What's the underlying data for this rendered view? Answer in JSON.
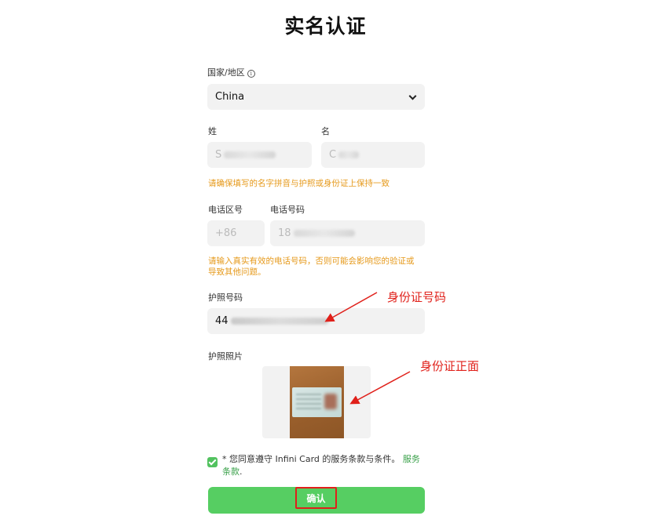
{
  "title": "实名认证",
  "country": {
    "label": "国家/地区",
    "info_icon": "info-icon",
    "value": "China"
  },
  "surname": {
    "label": "姓",
    "value_prefix": "S"
  },
  "given_name": {
    "label": "名",
    "value_prefix": "C"
  },
  "name_warning": "请确保填写的名字拼音与护照或身份证上保持一致",
  "area_code": {
    "label": "电话区号",
    "value": "+86"
  },
  "phone": {
    "label": "电话号码",
    "value_prefix": "18"
  },
  "phone_warning_line1": "请输入真实有效的电话号码，否则可能会影响您的验证或",
  "phone_warning_line2": "导致其他问题。",
  "passport_number": {
    "label": "护照号码",
    "value_prefix": "44"
  },
  "passport_photo": {
    "label": "护照照片"
  },
  "agreement": {
    "text": "* 您同意遵守 Infini Card 的服务条款与条件。",
    "link": "服务条款",
    "link_end": "."
  },
  "confirm_label": "确认",
  "annotations": {
    "id_number": "身份证号码",
    "id_front": "身份证正面"
  },
  "colors": {
    "accent_green": "#56ce62",
    "warning_orange": "#e69a1c",
    "annotation_red": "#e0201a"
  }
}
